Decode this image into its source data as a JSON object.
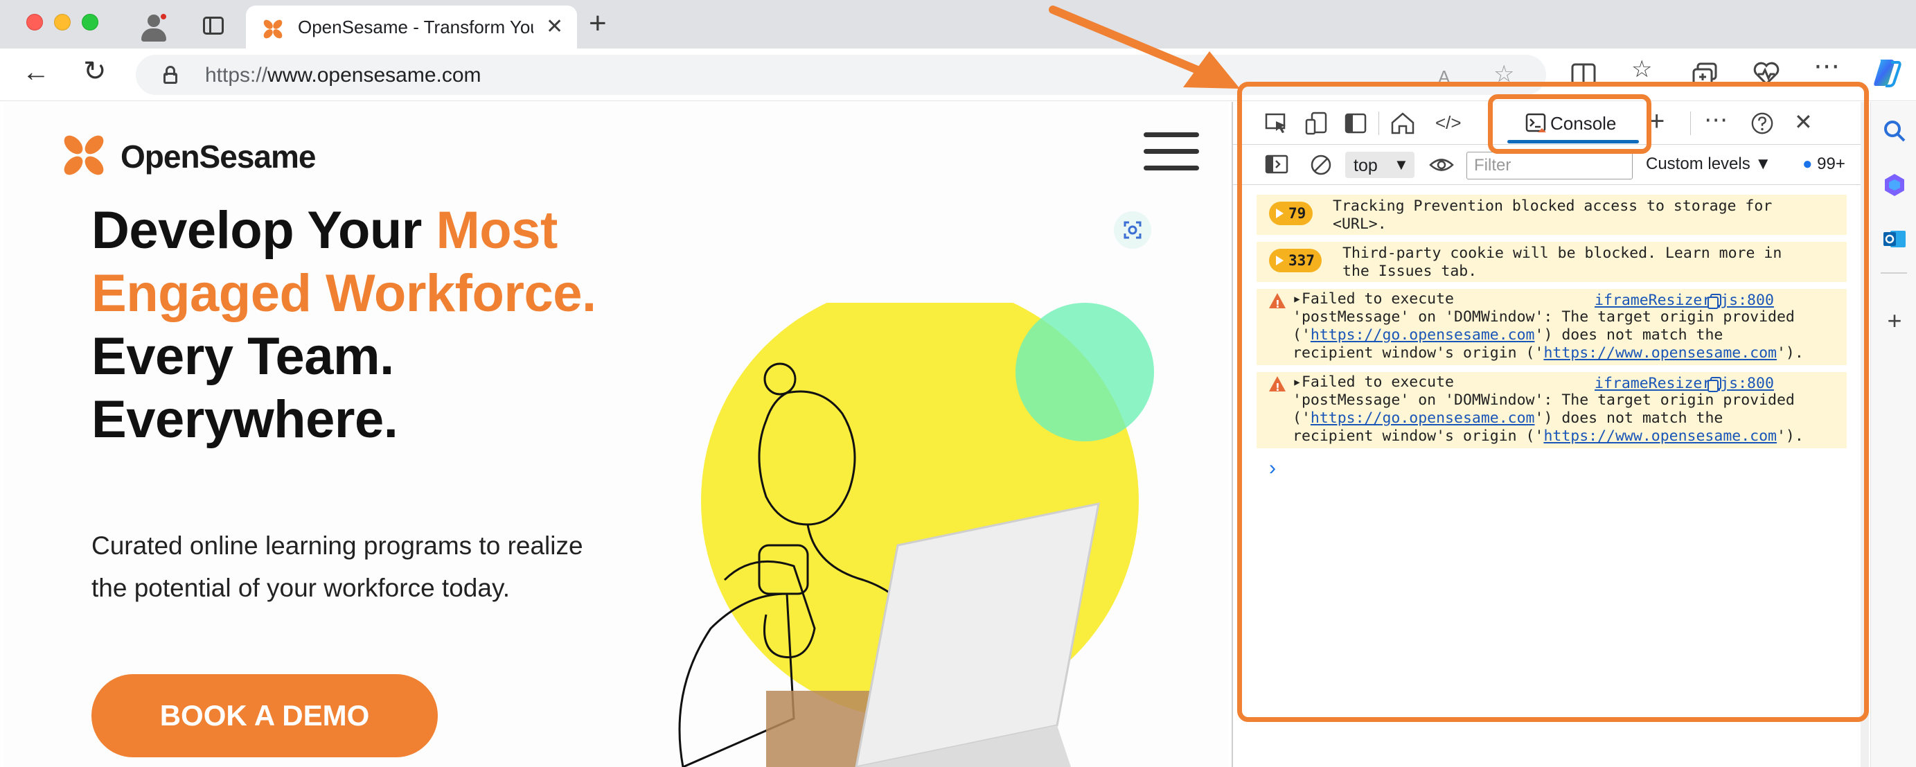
{
  "browser": {
    "tab_title": "OpenSesame - Transform Your",
    "url_scheme": "https://",
    "url_host": "www.opensesame.com"
  },
  "page": {
    "logo_text": "OpenSesame",
    "headline": {
      "part1": "Develop Your ",
      "accent": "Most Engaged Workforce.",
      "part2": " Every Team. Everywhere."
    },
    "subcopy": "Curated online learning programs to realize the potential of your workforce today.",
    "cta_label": "BOOK A DEMO"
  },
  "devtools": {
    "active_tab": "Console",
    "context": "top",
    "filter_placeholder": "Filter",
    "levels": "Custom levels",
    "issues_count": "99+",
    "messages": [
      {
        "type": "group",
        "count": "79",
        "line1": "Tracking Prevention blocked access to storage for",
        "line2": "<URL>."
      },
      {
        "type": "group",
        "count": "337",
        "line1": "Third-party cookie will be blocked. Learn more in",
        "line2": "the Issues tab."
      },
      {
        "type": "warning",
        "head": "Failed to execute",
        "source": "iframeResizer.js:800",
        "line2": "'postMessage' on 'DOMWindow': The target origin provided",
        "line3_pre": "('",
        "line3_link": "https://go.opensesame.com",
        "line3_post": "') does not match the",
        "line4_pre": "recipient window's origin ('",
        "line4_link": "https://www.opensesame.com",
        "line4_post": "')."
      },
      {
        "type": "warning",
        "head": "Failed to execute",
        "source": "iframeResizer.js:800",
        "line2": "'postMessage' on 'DOMWindow': The target origin provided",
        "line3_pre": "('",
        "line3_link": "https://go.opensesame.com",
        "line3_post": "') does not match the",
        "line4_pre": "recipient window's origin ('",
        "line4_link": "https://www.opensesame.com",
        "line4_post": "')."
      }
    ]
  },
  "colors": {
    "brand_orange": "#f08032",
    "annotation": "#f08032",
    "link": "#1a55b8",
    "warning_bg": "#fef6d5"
  },
  "icons": [
    "profile-icon",
    "tabs-icon",
    "back-icon",
    "reload-icon",
    "lock-icon",
    "read-aloud-icon",
    "favorite-icon",
    "split-screen-icon",
    "favorites-icon",
    "collections-icon",
    "health-icon",
    "more-icon",
    "copilot-icon",
    "inspect-icon",
    "device-icon",
    "dock-icon",
    "welcome-icon",
    "elements-icon",
    "console-icon",
    "add-tool-icon",
    "help-icon",
    "close-icon",
    "sidebar-toggle-icon",
    "clear-icon",
    "eye-icon",
    "issues-icon",
    "search-icon",
    "outlook-icon"
  ]
}
